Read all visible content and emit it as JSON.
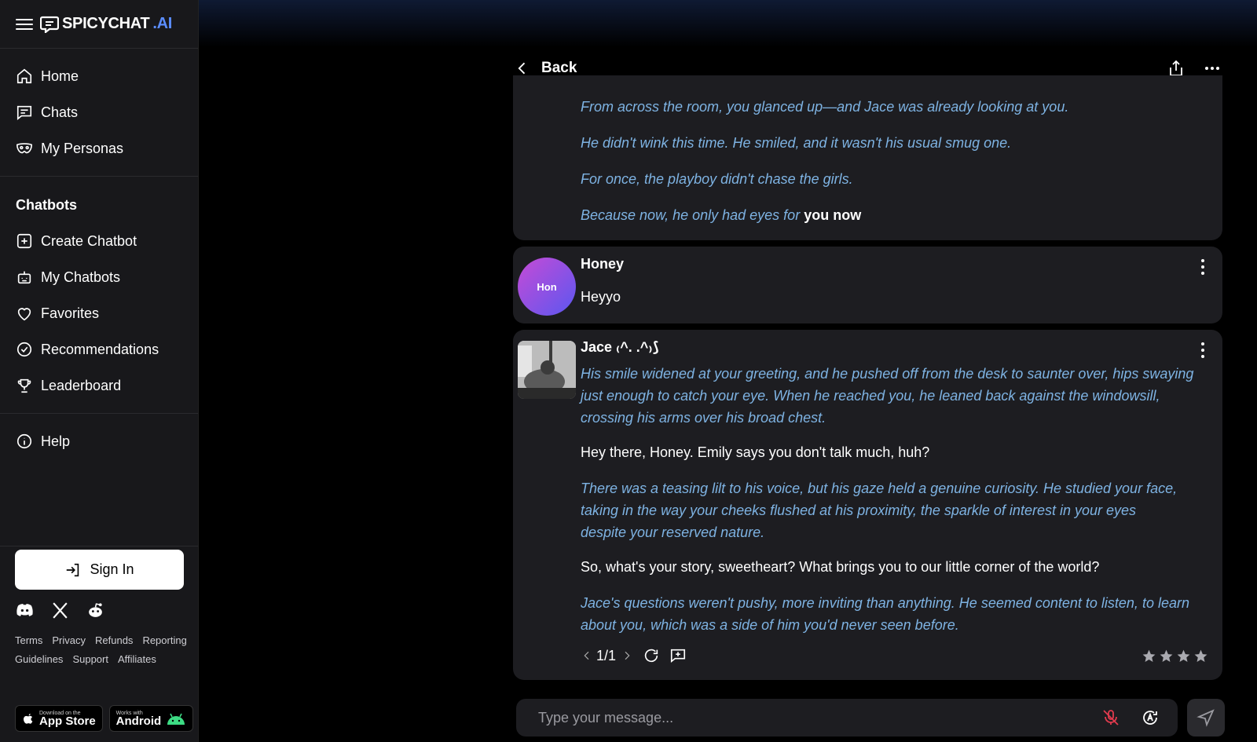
{
  "brand": {
    "name": "SPICYCHAT",
    "suffix": ".AI"
  },
  "nav": {
    "main": [
      {
        "label": "Home",
        "icon": "home-icon"
      },
      {
        "label": "Chats",
        "icon": "chat-icon"
      },
      {
        "label": "My Personas",
        "icon": "mask-icon"
      }
    ],
    "section_title": "Chatbots",
    "chatbots": [
      {
        "label": "Create Chatbot",
        "icon": "plus-square-icon"
      },
      {
        "label": "My Chatbots",
        "icon": "robot-icon"
      },
      {
        "label": "Favorites",
        "icon": "heart-icon"
      },
      {
        "label": "Recommendations",
        "icon": "check-badge-icon"
      },
      {
        "label": "Leaderboard",
        "icon": "trophy-icon"
      }
    ],
    "help": {
      "label": "Help",
      "icon": "info-icon"
    }
  },
  "signin_label": "Sign In",
  "footer_links": [
    "Terms",
    "Privacy",
    "Refunds",
    "Reporting",
    "Guidelines",
    "Support",
    "Affiliates"
  ],
  "stores": {
    "apple_small": "Download on the",
    "apple_big": "App Store",
    "android_small": "Works with",
    "android_big": "Android"
  },
  "header": {
    "back_label": "Back"
  },
  "messages": {
    "first": {
      "lines": [
        "From across the room, you glanced up—and Jace was already looking at you.",
        "He didn't wink this time. He smiled, and it wasn't his usual smug one.",
        "For once, the playboy didn't chase the girls."
      ],
      "last_prefix": "Because now, he only had eyes for",
      "last_bold": "you now"
    },
    "user": {
      "avatar_text": "Hon",
      "name": "Honey",
      "text": "Heyyo"
    },
    "bot": {
      "name": "Jace ₍^. .^₎⟆",
      "p1": "His smile widened at your greeting, and he pushed off from the desk to saunter over, hips swaying just enough to catch your eye. When he reached you, he leaned back against the windowsill, crossing his arms over his broad chest.",
      "p2": "Hey there, Honey. Emily says you don't talk much, huh?",
      "p3": "There was a teasing lilt to his voice, but his gaze held a genuine curiosity. He studied your face, taking in the way your cheeks flushed at his proximity, the sparkle of interest in your eyes despite your reserved nature.",
      "p4": "So, what's your story, sweetheart? What brings you to our little corner of the world?",
      "p5": "Jace's questions weren't pushy, more inviting than anything. He seemed content to listen, to learn about you, which was a side of him you'd never seen before.",
      "pager": "1/1",
      "rating_stars": 4
    }
  },
  "composer": {
    "placeholder": "Type your message..."
  },
  "colors": {
    "accent": "#5b8dff",
    "italic_text": "#7eb3e3",
    "panel": "#1d1d21",
    "sidebar": "#18181b"
  }
}
